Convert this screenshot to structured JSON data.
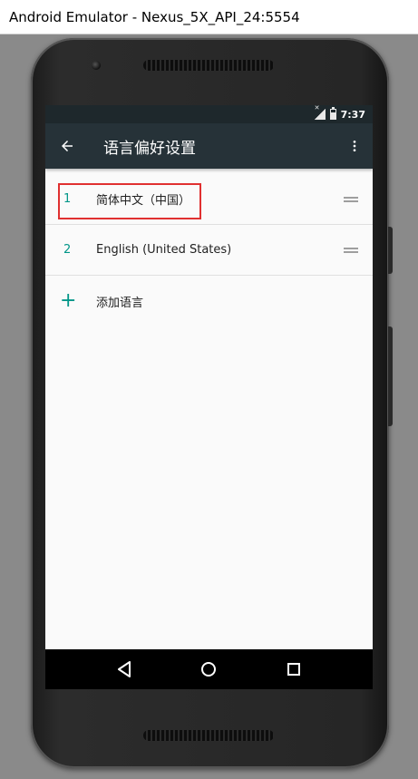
{
  "window": {
    "title": "Android Emulator - Nexus_5X_API_24:5554"
  },
  "status_bar": {
    "time": "7:37"
  },
  "app_bar": {
    "title": "语言偏好设置",
    "back_icon": "arrow-back-icon",
    "more_icon": "more-vert-icon"
  },
  "languages": [
    {
      "number": "1",
      "label": "简体中文（中国）"
    },
    {
      "number": "2",
      "label": "English (United States)"
    }
  ],
  "add_language": {
    "icon": "+",
    "label": "添加语言"
  },
  "nav_bar": {
    "back_icon": "nav-back-icon",
    "home_icon": "nav-home-icon",
    "recents_icon": "nav-recents-icon"
  },
  "colors": {
    "accent": "#009688",
    "app_bar": "#263238",
    "status_bar": "#1e282c",
    "highlight": "#e03030"
  }
}
